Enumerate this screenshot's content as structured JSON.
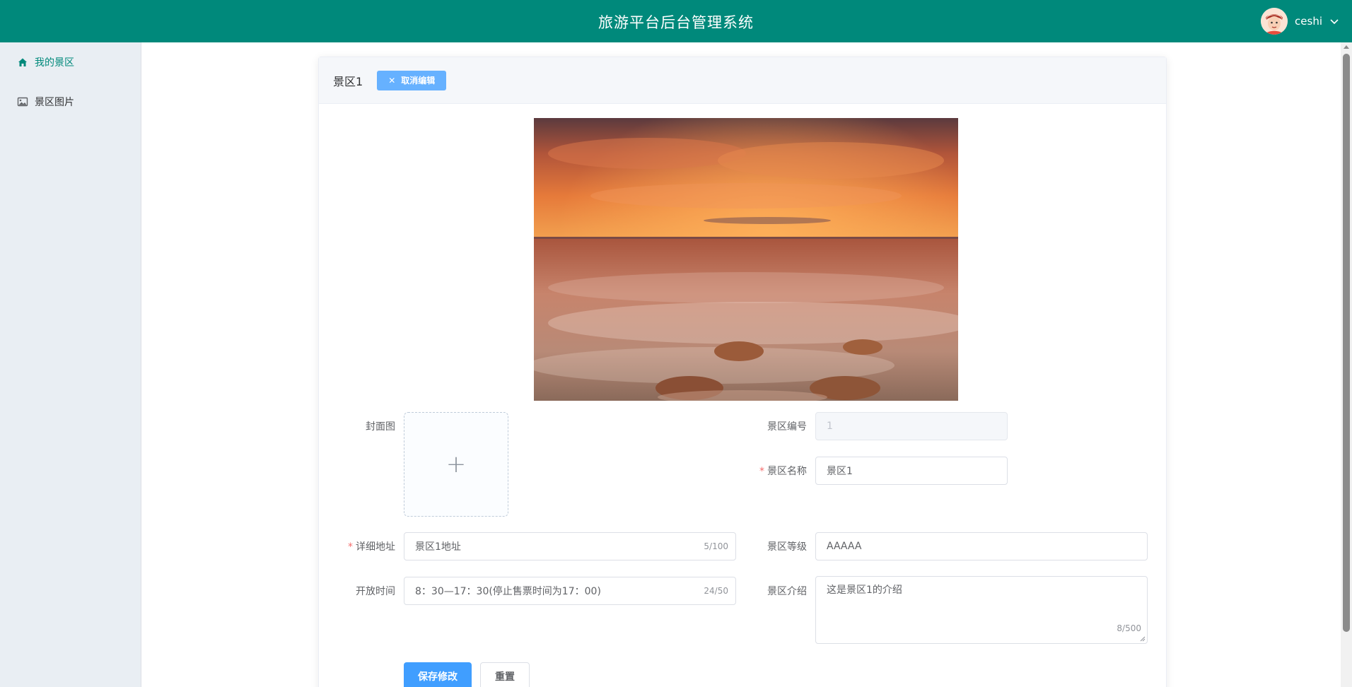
{
  "header": {
    "title": "旅游平台后台管理系统",
    "username": "ceshi"
  },
  "sidebar": {
    "items": [
      {
        "label": "我的景区",
        "icon": "home-icon",
        "active": true
      },
      {
        "label": "景区图片",
        "icon": "image-icon",
        "active": false
      }
    ]
  },
  "card": {
    "name": "景区1",
    "cancel_label": "取消编辑"
  },
  "form": {
    "cover_label": "封面图",
    "id_label": "景区编号",
    "id_value": "1",
    "name_label": "景区名称",
    "name_value": "景区1",
    "address_label": "详细地址",
    "address_value": "景区1地址",
    "address_count": "5/100",
    "level_label": "景区等级",
    "level_value": "AAAAA",
    "hours_label": "开放时间",
    "hours_value": "8：30—17：30(停止售票时间为17：00)",
    "hours_count": "24/50",
    "intro_label": "景区介绍",
    "intro_value": "这是景区1的介绍",
    "intro_count": "8/500",
    "required_mark": "*",
    "save_label": "保存修改",
    "reset_label": "重置"
  },
  "colors": {
    "header": "#00897b",
    "sidebar": "#e9eef3",
    "primary": "#409eff",
    "cancel_button": "#66b1ff"
  }
}
